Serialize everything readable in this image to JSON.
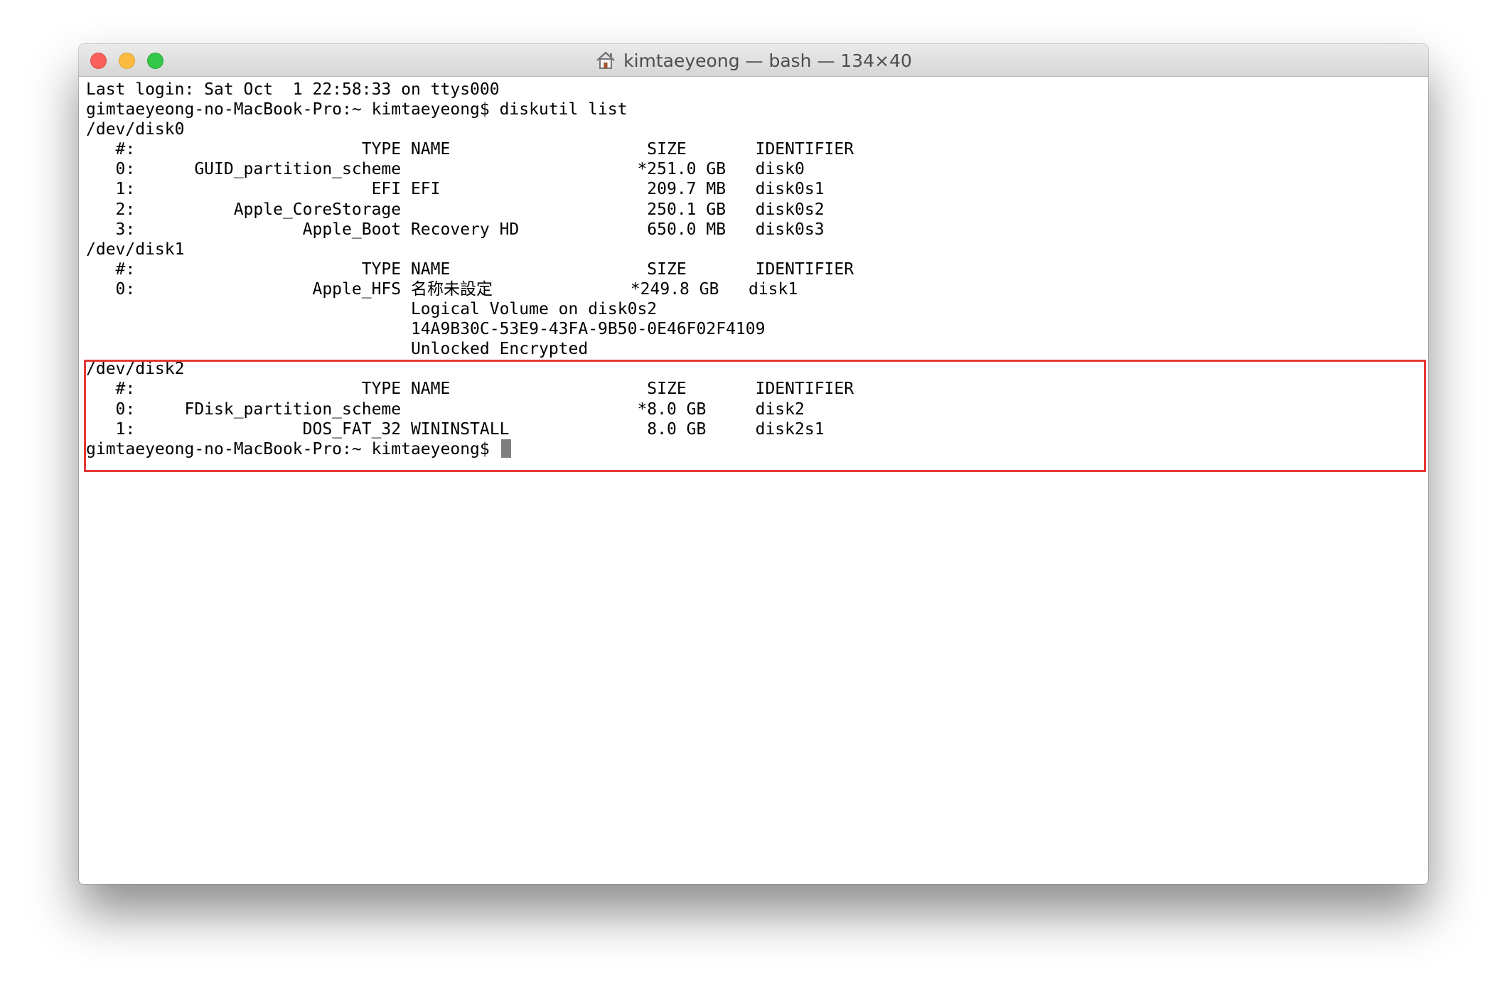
{
  "window": {
    "title": "kimtaeyeong — bash — 134×40",
    "title_icon": "home-icon"
  },
  "terminal": {
    "lines": [
      "Last login: Sat Oct  1 22:58:33 on ttys000",
      "gimtaeyeong-no-MacBook-Pro:~ kimtaeyeong$ diskutil list",
      "/dev/disk0",
      "   #:                       TYPE NAME                    SIZE       IDENTIFIER",
      "   0:      GUID_partition_scheme                        *251.0 GB   disk0",
      "   1:                        EFI EFI                     209.7 MB   disk0s1",
      "   2:          Apple_CoreStorage                         250.1 GB   disk0s2",
      "   3:                 Apple_Boot Recovery HD             650.0 MB   disk0s3",
      "/dev/disk1",
      "   #:                       TYPE NAME                    SIZE       IDENTIFIER",
      "   0:                  Apple_HFS 名称未設定              *249.8 GB   disk1",
      "                                 Logical Volume on disk0s2",
      "                                 14A9B30C-53E9-43FA-9B50-0E46F02F4109",
      "                                 Unlocked Encrypted",
      "/dev/disk2",
      "   #:                       TYPE NAME                    SIZE       IDENTIFIER",
      "   0:     FDisk_partition_scheme                        *8.0 GB     disk2",
      "   1:                 DOS_FAT_32 WININSTALL              8.0 GB     disk2s1"
    ],
    "prompt": "gimtaeyeong-no-MacBook-Pro:~ kimtaeyeong$ "
  },
  "colors": {
    "highlight": "#e53935",
    "close": "#fc605c",
    "minimize": "#fdbc40",
    "zoom": "#34c84a"
  }
}
